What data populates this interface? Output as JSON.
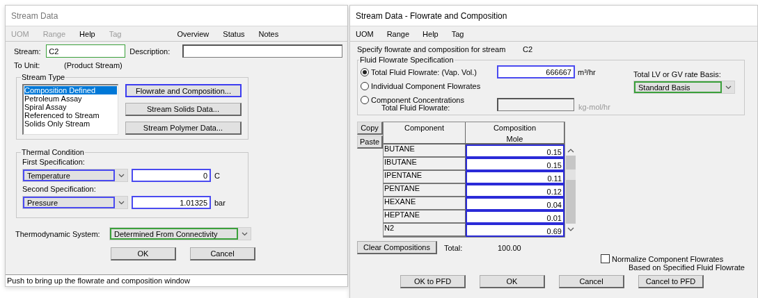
{
  "stream_data_window": {
    "title": "Stream Data",
    "menu": [
      {
        "label": "UOM",
        "disabled": true
      },
      {
        "label": "Range",
        "disabled": true
      },
      {
        "label": "Help",
        "disabled": false
      },
      {
        "label": "Tag",
        "disabled": true
      }
    ],
    "links": [
      "Overview",
      "Status",
      "Notes"
    ],
    "stream_field": {
      "label": "Stream:",
      "value": "C2"
    },
    "description_field": {
      "label": "Description:"
    },
    "to_unit": {
      "label": "To Unit:",
      "value": "(Product Stream)"
    },
    "stream_type": {
      "title": "Stream Type",
      "items": [
        {
          "label": "Composition Defined",
          "selected": true
        },
        {
          "label": "Petroleum Assay",
          "selected": false
        },
        {
          "label": "Spiral Assay",
          "selected": false
        },
        {
          "label": "Referenced to Stream",
          "selected": false
        },
        {
          "label": "Solids Only Stream",
          "selected": false
        }
      ],
      "buttons": [
        {
          "label": "Flowrate and Composition...",
          "focused": true
        },
        {
          "label": "Stream Solids Data...",
          "focused": false
        },
        {
          "label": "Stream Polymer Data...",
          "focused": false
        }
      ]
    },
    "thermal_condition": {
      "title": "Thermal Condition",
      "specs": [
        {
          "label": "First Specification:",
          "option": "Temperature",
          "value": "0",
          "unit": "C"
        },
        {
          "label": "Second Specification:",
          "option": "Pressure",
          "value": "1.01325",
          "unit": "bar"
        }
      ]
    },
    "thermodynamic_system": {
      "label": "Thermodynamic System:",
      "value": "Determined From Connectivity"
    },
    "buttons": [
      "OK",
      "Cancel"
    ],
    "status_bar": "Push to bring up the flowrate and composition window"
  },
  "flowrate_window": {
    "title": "Stream Data - Flowrate and Composition",
    "menu": [
      {
        "label": "UOM",
        "disabled": false
      },
      {
        "label": "Range",
        "disabled": false
      },
      {
        "label": "Help",
        "disabled": false
      },
      {
        "label": "Tag",
        "disabled": false
      }
    ],
    "intro": {
      "label": "Specify flowrate and composition for stream",
      "stream": "C2"
    },
    "fluid_flowrate": {
      "title": "Fluid Flowrate Specification",
      "options": [
        {
          "label": "Total Fluid Flowrate: (Vap. Vol.)",
          "selected": true
        },
        {
          "label": "Individual Component Flowrates",
          "selected": false
        },
        {
          "label": "Component Concentrations",
          "selected": false
        }
      ],
      "flow_value": "666667",
      "flow_unit": "m³/hr",
      "total_label": "Total Fluid Flowrate:",
      "total_unit": "kg-mol/hr",
      "basis_label": "Total LV or GV rate Basis:",
      "basis_value": "Standard Basis"
    },
    "grid_buttons": [
      "Copy",
      "Paste"
    ],
    "table": {
      "columns": [
        {
          "label": "Component"
        },
        {
          "label": "Composition",
          "unit": "Mole"
        }
      ],
      "rows": [
        {
          "component": "BUTANE",
          "value": "0.15"
        },
        {
          "component": "IBUTANE",
          "value": "0.15"
        },
        {
          "component": "IPENTANE",
          "value": "0.11"
        },
        {
          "component": "PENTANE",
          "value": "0.12"
        },
        {
          "component": "HEXANE",
          "value": "0.04"
        },
        {
          "component": "HEPTANE",
          "value": "0.01"
        },
        {
          "component": "N2",
          "value": "0.69"
        }
      ]
    },
    "clear_button": "Clear Compositions",
    "total": {
      "label": "Total:",
      "value": "100.00"
    },
    "normalize": {
      "label": "Normalize Component Flowrates",
      "sublabel": "Based on Specified Fluid Flowrate",
      "checked": false
    },
    "buttons": [
      "OK to PFD",
      "OK",
      "Cancel",
      "Cancel to PFD"
    ]
  }
}
